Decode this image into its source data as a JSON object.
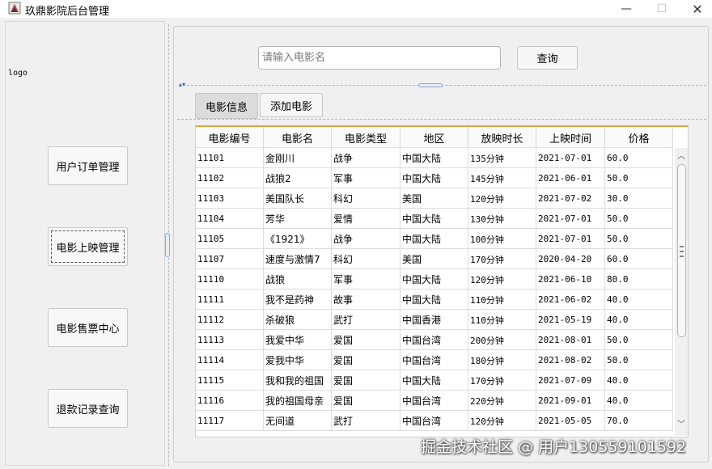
{
  "window": {
    "title": "玖鼎影院后台管理",
    "minimize_glyph": "—",
    "maximize_glyph": "☐",
    "close_glyph": "✕"
  },
  "sidebar": {
    "logo_text": "logo",
    "items": [
      {
        "label": "用户订单管理",
        "active": false
      },
      {
        "label": "电影上映管理",
        "active": true
      },
      {
        "label": "电影售票中心",
        "active": false
      },
      {
        "label": "退款记录查询",
        "active": false
      }
    ]
  },
  "search": {
    "placeholder": "请输入电影名",
    "value": "",
    "button_label": "查询"
  },
  "tabs": [
    {
      "label": "电影信息",
      "selected": true
    },
    {
      "label": "添加电影",
      "selected": false
    }
  ],
  "table": {
    "columns": [
      "电影编号",
      "电影名",
      "电影类型",
      "地区",
      "放映时长",
      "上映时间",
      "价格"
    ],
    "rows": [
      [
        "11101",
        "金刚川",
        "战争",
        "中国大陆",
        "135分钟",
        "2021-07-01",
        "60.0"
      ],
      [
        "11102",
        "战狼2",
        "军事",
        "中国大陆",
        "145分钟",
        "2021-06-01",
        "50.0"
      ],
      [
        "11103",
        "美国队长",
        "科幻",
        "美国",
        "120分钟",
        "2021-07-02",
        "30.0"
      ],
      [
        "11104",
        "芳华",
        "爱情",
        "中国大陆",
        "130分钟",
        "2021-07-01",
        "50.0"
      ],
      [
        "11105",
        "《1921》",
        "战争",
        "中国大陆",
        "100分钟",
        "2021-07-01",
        "50.0"
      ],
      [
        "11107",
        "速度与激情7",
        "科幻",
        "美国",
        "170分钟",
        "2020-04-20",
        "60.0"
      ],
      [
        "11110",
        "战狼",
        "军事",
        "中国大陆",
        "120分钟",
        "2021-06-10",
        "80.0"
      ],
      [
        "11111",
        "我不是药神",
        "故事",
        "中国大陆",
        "110分钟",
        "2021-06-02",
        "40.0"
      ],
      [
        "11112",
        "杀破狼",
        "武打",
        "中国香港",
        "110分钟",
        "2021-05-19",
        "40.0"
      ],
      [
        "11113",
        "我爱中华",
        "爱国",
        "中国台湾",
        "200分钟",
        "2021-08-01",
        "50.0"
      ],
      [
        "11114",
        "爱我中华",
        "爱国",
        "中国台湾",
        "180分钟",
        "2021-08-02",
        "50.0"
      ],
      [
        "11115",
        "我和我的祖国",
        "爱国",
        "中国大陆",
        "170分钟",
        "2021-07-09",
        "40.0"
      ],
      [
        "11116",
        "我的祖国母亲",
        "爱国",
        "中国台湾",
        "220分钟",
        "2021-09-01",
        "40.0"
      ],
      [
        "11117",
        "无间道",
        "武打",
        "中国台湾",
        "120分钟",
        "2021-05-05",
        "70.0"
      ]
    ]
  },
  "scrollbar": {
    "up_glyph": "︿",
    "down_glyph": "﹀"
  },
  "watermark": "掘金技术社区 @ 用户130559101592",
  "colors": {
    "table_top_accent": "#e8a33a",
    "splitter_accent": "#88a8d8"
  }
}
